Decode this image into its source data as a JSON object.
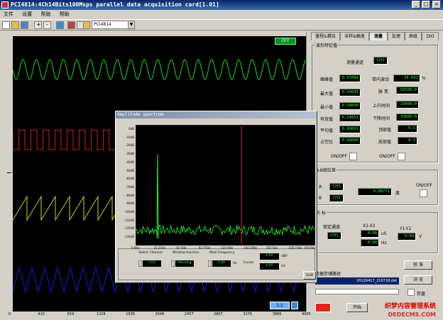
{
  "window": {
    "title": "PCI4814:4Ch14Bits100Msps parallel data acquisition card[1.01]",
    "icon": "app-icon",
    "controls": [
      "_",
      "□",
      "×"
    ]
  },
  "menu": [
    "文件",
    "设置",
    "帮助",
    "帮助"
  ],
  "toolbar": {
    "card_select": "PCI4814",
    "icons": [
      "new-file-icon",
      "open-folder-icon",
      "save-icon",
      "zoom-in-icon",
      "zoom-out-icon",
      "chart-icon",
      "book-icon",
      "stop-icon",
      "play-icon"
    ]
  },
  "scope": {
    "indicator": "OFF",
    "x_ticks": [
      "0",
      "410",
      "819",
      "1228",
      "1638",
      "2048",
      "2457",
      "2867",
      "3276",
      "3686",
      "4095"
    ],
    "cursor_readout": "1:1",
    "trace_colors": [
      "#19d919",
      "#d11a1a",
      "#d6cf1c",
      "#1a1ad6"
    ]
  },
  "tabs": [
    "量程&耦合",
    "采样&触发",
    "测量",
    "处理",
    "高级",
    "DIO"
  ],
  "active_tab": "测量",
  "waveform": {
    "group_label": "波形特征值",
    "measure_channel_label": "测量通道",
    "measure_channel": "CH1",
    "rows_left": [
      {
        "label": "峰峰值",
        "value": "0.55084"
      },
      {
        "label": "最大值",
        "value": "0.34043"
      },
      {
        "label": "最小值",
        "value": "0.34040"
      },
      {
        "label": "有效值",
        "value": "0.24051"
      },
      {
        "label": "平均值",
        "value": "0.00001"
      },
      {
        "label": "占空比",
        "value": "0.00000"
      }
    ],
    "bandwidth_label": "带内波动",
    "bandwidth_value": "34.042",
    "bandwidth_unit": "%",
    "rows_right": [
      {
        "label": "脉 宽",
        "value": "56500.0"
      },
      {
        "label": "上升时间",
        "value": "33000.0"
      },
      {
        "label": "下降时间",
        "value": "33000.0"
      },
      {
        "label": "顶部值",
        "value": "-0.3"
      },
      {
        "label": "底部值",
        "value": "0.3"
      }
    ],
    "onoff_left": "ON/OFF",
    "onoff_right": "ON/OFF"
  },
  "ab_group": {
    "label": "A-B相位差",
    "a_label": "A",
    "a_ch": "CH1",
    "b_label": "B",
    "b_ch": "CH2",
    "value": "0.08771",
    "unit": "度",
    "onoff": "ON/OFF"
  },
  "cursor_group": {
    "label": "光 标",
    "lock_label": "锁定通道",
    "lock_ch": "CH1",
    "x_label": "X1-X2",
    "x_val1": "0.00",
    "x_unit1": "uS",
    "x_val2": "0.00",
    "x_unit2": "Hz",
    "y_label": "Y1-Y2",
    "y_val": "0.00",
    "y_unit": "V"
  },
  "bottom": {
    "file_label": "数据存储路径",
    "file_name": "20120417_210718.dat",
    "calibrate": "校 准",
    "browse": "浏 览",
    "save_label": "存盘",
    "start": "开始"
  },
  "popup": {
    "title": "Amplitude spectrum",
    "y_ticks": [
      "0dB",
      "-10dB",
      "-20dB",
      "-30dB",
      "-40dB",
      "-50dB",
      "-60dB",
      "-70dB",
      "-80dB",
      "-90dB",
      "-100dB",
      "-110dB",
      "-120dB",
      "-130dB"
    ],
    "x_ticks": [
      "0.0Hz",
      "31.25Hz",
      "62.5Hz",
      "93.75Hz",
      "125.0Hz",
      "156.25Hz",
      "187.5Hz",
      "218.75Hz",
      "250.0Hz"
    ],
    "select_channel_label": "Select Channel",
    "select_channel": "CH1",
    "window_label": "Window function",
    "window_value": "Hanning",
    "main_freq_label": "Main Frequency",
    "main_freq_value": "0.00",
    "main_freq_unit": "Hz",
    "cursor_label": "Cursor",
    "cursor_db": "0.00",
    "cursor_db_unit": "dBV",
    "cursor_hz": "0.00",
    "cursor_hz_unit": "Hz",
    "exit": "Quit"
  },
  "watermark": {
    "line1": "织梦内容管理系统",
    "line2": "DEDECMS.COM"
  }
}
